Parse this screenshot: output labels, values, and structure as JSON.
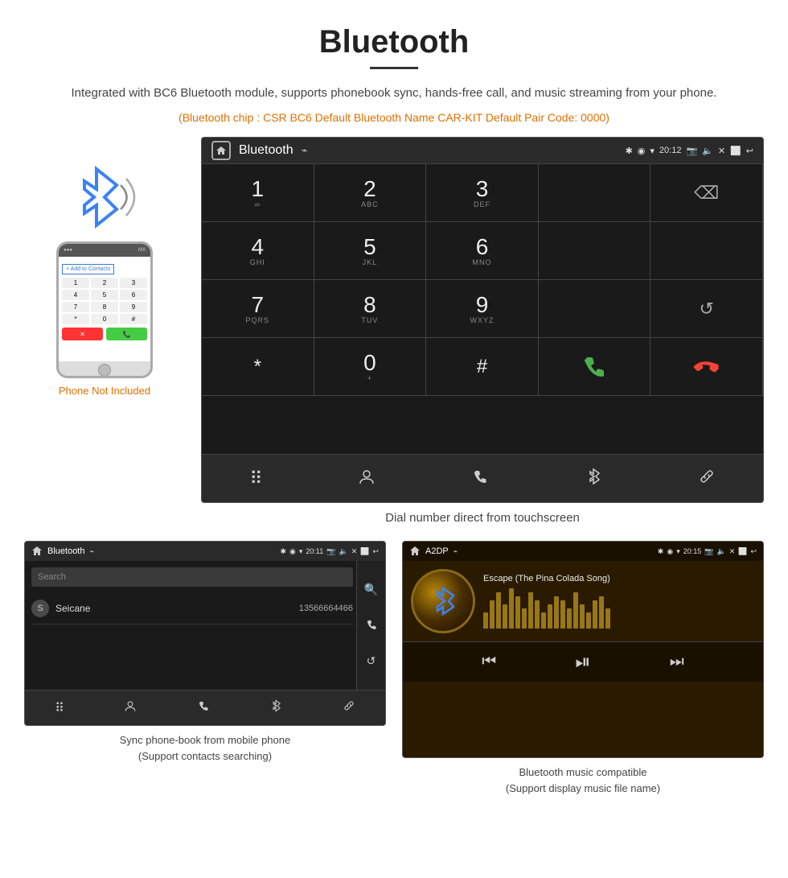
{
  "page": {
    "title": "Bluetooth",
    "subtitle": "Integrated with BC6 Bluetooth module, supports phonebook sync, hands-free call, and music streaming from your phone.",
    "orange_info": "(Bluetooth chip : CSR BC6    Default Bluetooth Name CAR-KIT    Default Pair Code: 0000)"
  },
  "main_screen": {
    "status_bar": {
      "app_title": "Bluetooth",
      "usb_symbol": "⌁",
      "bt_symbol": "✱",
      "gps_symbol": "◉",
      "signal": "▾",
      "time": "20:12",
      "icons_right": [
        "📷",
        "🔈",
        "✕",
        "⬜",
        "↩"
      ]
    },
    "dialpad": {
      "keys": [
        {
          "num": "1",
          "sub": "∞"
        },
        {
          "num": "2",
          "sub": "ABC"
        },
        {
          "num": "3",
          "sub": "DEF"
        },
        {
          "num": "",
          "sub": ""
        },
        {
          "num": "⌫",
          "sub": ""
        },
        {
          "num": "4",
          "sub": "GHI"
        },
        {
          "num": "5",
          "sub": "JKL"
        },
        {
          "num": "6",
          "sub": "MNO"
        },
        {
          "num": "",
          "sub": ""
        },
        {
          "num": "",
          "sub": ""
        },
        {
          "num": "7",
          "sub": "PQRS"
        },
        {
          "num": "8",
          "sub": "TUV"
        },
        {
          "num": "9",
          "sub": "WXYZ"
        },
        {
          "num": "",
          "sub": ""
        },
        {
          "num": "↺",
          "sub": ""
        },
        {
          "num": "*",
          "sub": ""
        },
        {
          "num": "0",
          "sub": "+"
        },
        {
          "num": "#",
          "sub": ""
        },
        {
          "num": "📞",
          "sub": "green"
        },
        {
          "num": "📵",
          "sub": "red"
        }
      ],
      "bottom_nav": [
        "⠿",
        "👤",
        "📞",
        "✱",
        "🔗"
      ]
    }
  },
  "dial_caption": "Dial number direct from touchscreen",
  "left_panel": {
    "phone_not_included": "Phone Not Included"
  },
  "phonebook_screen": {
    "status_bar": {
      "app_title": "Bluetooth",
      "time": "20:11"
    },
    "search_placeholder": "Search",
    "contacts": [
      {
        "letter": "S",
        "name": "Seicane",
        "number": "13566664466"
      }
    ],
    "sidebar_icons": [
      "🔍",
      "📞",
      "↺"
    ],
    "bottom_nav": [
      "⠿",
      "👤",
      "📞",
      "✱",
      "🔗"
    ]
  },
  "phonebook_caption": "Sync phone-book from mobile phone\n(Support contacts searching)",
  "music_screen": {
    "status_bar": {
      "app_title": "A2DP",
      "time": "20:15"
    },
    "song_title": "Escape (The Pina Colada Song)",
    "eq_bars": [
      20,
      35,
      45,
      30,
      50,
      40,
      25,
      45,
      35,
      20,
      30,
      40,
      35,
      25,
      45,
      30,
      20,
      35,
      40,
      25
    ],
    "controls": [
      "⏮",
      "⏯",
      "⏭"
    ]
  },
  "music_caption": "Bluetooth music compatible\n(Support display music file name)"
}
